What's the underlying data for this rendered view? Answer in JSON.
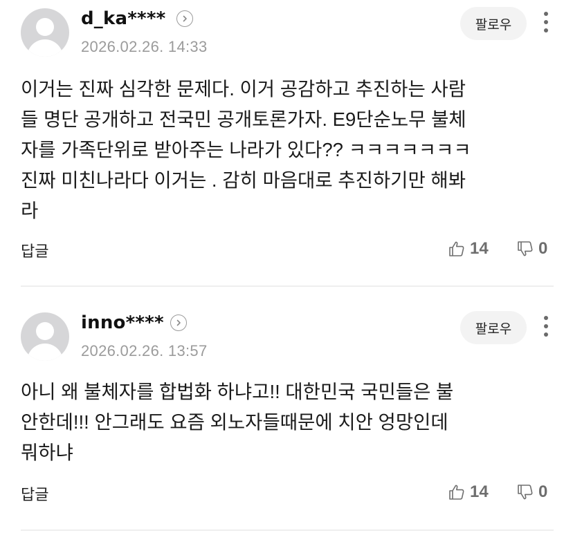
{
  "comments": [
    {
      "username": "d_ka****",
      "timestamp": "2026.02.26. 14:33",
      "follow_label": "팔로우",
      "lines": [
        "이거는 진짜 심각한 문제다. 이거 공감하고 추진하는 사람",
        "들 명단 공개하고 전국민 공개토론가자. E9단순노무 불체",
        "자를 가족단위로 받아주는 나라가 있다?? ㅋㅋㅋㅋㅋㅋㅋ",
        "진짜 미친나라다 이거는 . 감히 마음대로 추진하기만 해봐",
        "라"
      ],
      "reply_label": "답글",
      "likes": "14",
      "dislikes": "0"
    },
    {
      "username": "inno****",
      "timestamp": "2026.02.26. 13:57",
      "follow_label": "팔로우",
      "lines": [
        "아니 왜 불체자를 합법화 하냐고!! 대한민국 국민들은 불",
        "안한데!!! 안그래도 요즘 외노자들때문에 치안 엉망인데",
        "뭐하냐"
      ],
      "reply_label": "답글",
      "likes": "14",
      "dislikes": "0"
    }
  ],
  "icons": {
    "profile_arrow": "chevron-right-icon",
    "like": "thumbs-up-icon",
    "dislike": "thumbs-down-icon",
    "more": "more-vertical-icon"
  }
}
